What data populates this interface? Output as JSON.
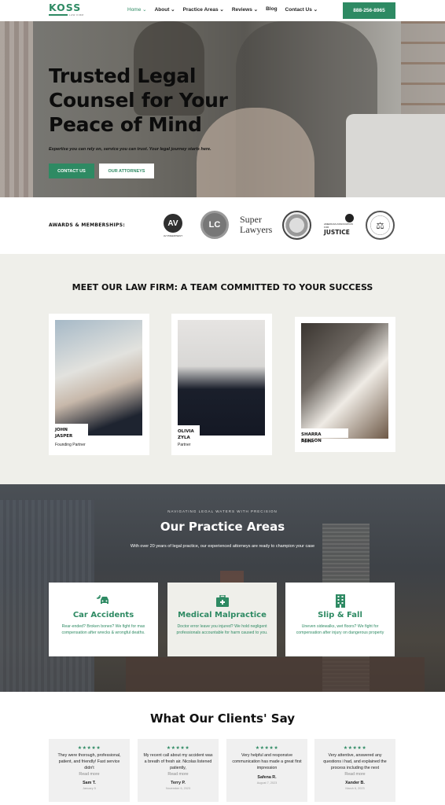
{
  "header": {
    "logo": {
      "name": "KOSS",
      "sub": "LAW FIRM"
    },
    "nav": [
      {
        "label": "Home ⌄",
        "active": true
      },
      {
        "label": "About ⌄"
      },
      {
        "label": "Practice Areas ⌄"
      },
      {
        "label": "Reviews ⌄"
      },
      {
        "label": "Blog"
      },
      {
        "label": "Contact Us ⌄"
      }
    ],
    "phone": "888-256-8965"
  },
  "hero": {
    "title": "Trusted Legal Counsel for Your Peace of Mind",
    "tagline": "Expertise you can rely on, service you can trust. Your legal journey starts here.",
    "primary_button": "CONTACT US",
    "secondary_button": "OUR ATTORNEYS"
  },
  "awards": {
    "label": "AWARDS & MEMBERSHIPS:",
    "badges": [
      {
        "name": "AV Preeminent",
        "text": "AV",
        "sub": "AV PREEMINENT"
      },
      {
        "name": "Lead Counsel",
        "text": "LC"
      },
      {
        "name": "Super Lawyers",
        "text": "Super Lawyers"
      },
      {
        "name": "Bar association seal"
      },
      {
        "name": "American Association for Justice",
        "sub": "AMERICAN ASSOCIATION FOR",
        "text": "JUSTICE"
      },
      {
        "name": "Million Dollar Advocates seal",
        "text": "⚖"
      }
    ]
  },
  "team": {
    "title": "MEET OUR LAW FIRM: A TEAM COMMITTED TO YOUR SUCCESS",
    "members": [
      {
        "name": "JOHN JASPER",
        "role": "Founding Partner"
      },
      {
        "name": "OLIVIA ZYLA",
        "role": "Partner"
      },
      {
        "name": "SHARRA BENSON",
        "role": "Partner"
      }
    ]
  },
  "practice": {
    "kicker": "NAVIGATING LEGAL WATERS WITH PRECISION",
    "title": "Our Practice Areas",
    "subtitle": "With over 20 years of legal practice, our experienced attorneys are ready to champion your case",
    "areas": [
      {
        "icon": "car-crash-icon",
        "title": "Car Accidents",
        "text": "Rear-ended? Broken bones? We fight for max compensation after wrecks & wrongful deaths."
      },
      {
        "icon": "medical-kit-icon",
        "title": "Medical Malpractice",
        "text": "Doctor error leave you injured? We hold negligent professionals accountable for harm caused to you."
      },
      {
        "icon": "building-icon",
        "title": "Slip & Fall",
        "text": "Uneven sidewalks, wet floors? We fight for compensation after injury on dangerous property"
      }
    ]
  },
  "reviews": {
    "title": "What Our Clients' Say",
    "items": [
      {
        "stars": "★★★★★",
        "text": "They were thorough, professional, patient, and friendly! Fast service didn't",
        "more": "Read more",
        "author": "Sam T.",
        "date": "January 5"
      },
      {
        "stars": "★★★★★",
        "text": "My recent call about my accident was a breath of fresh air. Nicolas listened patiently,",
        "more": "Read more",
        "author": "Terry P.",
        "date": "November 6, 2023"
      },
      {
        "stars": "★★★★★",
        "text": "Very helpful and responsive communication has made a great first impression",
        "more": "",
        "author": "Safena R.",
        "date": "August 7, 2023"
      },
      {
        "stars": "★★★★★",
        "text": "Very attentive, answered any questions i had, and explained the process including the next",
        "more": "Read more",
        "author": "Xander B.",
        "date": "March 6, 2023"
      }
    ]
  },
  "colors": {
    "accent": "#2e8a63",
    "section_bg": "#efefea"
  }
}
